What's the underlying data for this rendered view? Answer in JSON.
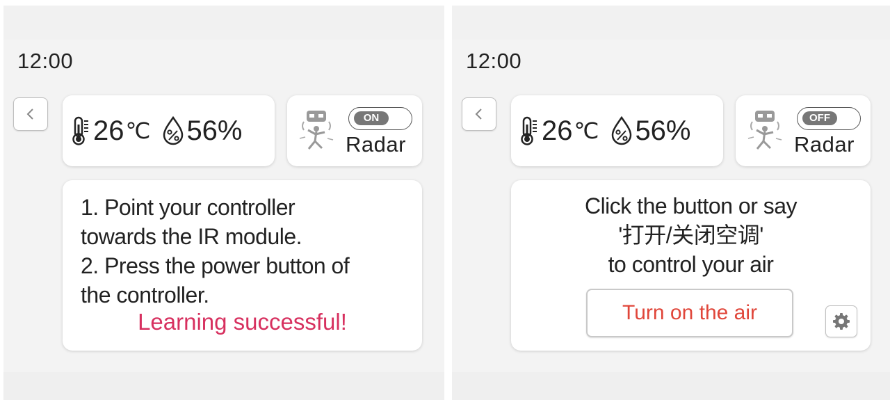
{
  "screens": [
    {
      "clock": "12:00",
      "sensors": {
        "temperature": "26",
        "temperature_unit": "℃",
        "humidity": "56%"
      },
      "radar": {
        "toggle_state": "ON",
        "label": "Radar"
      },
      "instructions": [
        "1.  Point your controller",
        "towards the IR module.",
        "2.  Press the power button of",
        "the controller."
      ],
      "status_message": "Learning successful!"
    },
    {
      "clock": "12:00",
      "sensors": {
        "temperature": "26",
        "temperature_unit": "℃",
        "humidity": "56%"
      },
      "radar": {
        "toggle_state": "OFF",
        "label": "Radar"
      },
      "prompt_lines": [
        "Click the button or say",
        "'打开/关闭空调'",
        "to control your air"
      ],
      "action_button_label": "Turn on the air"
    }
  ],
  "icons": {
    "back": "chevron-left-icon",
    "temperature": "thermometer-icon",
    "humidity": "humidity-drop-icon",
    "radar": "radar-sensor-icon",
    "settings": "gear-icon"
  },
  "colors": {
    "success_text": "#d7305f",
    "action_text": "#e0463a",
    "toggle_knob": "#777777"
  }
}
